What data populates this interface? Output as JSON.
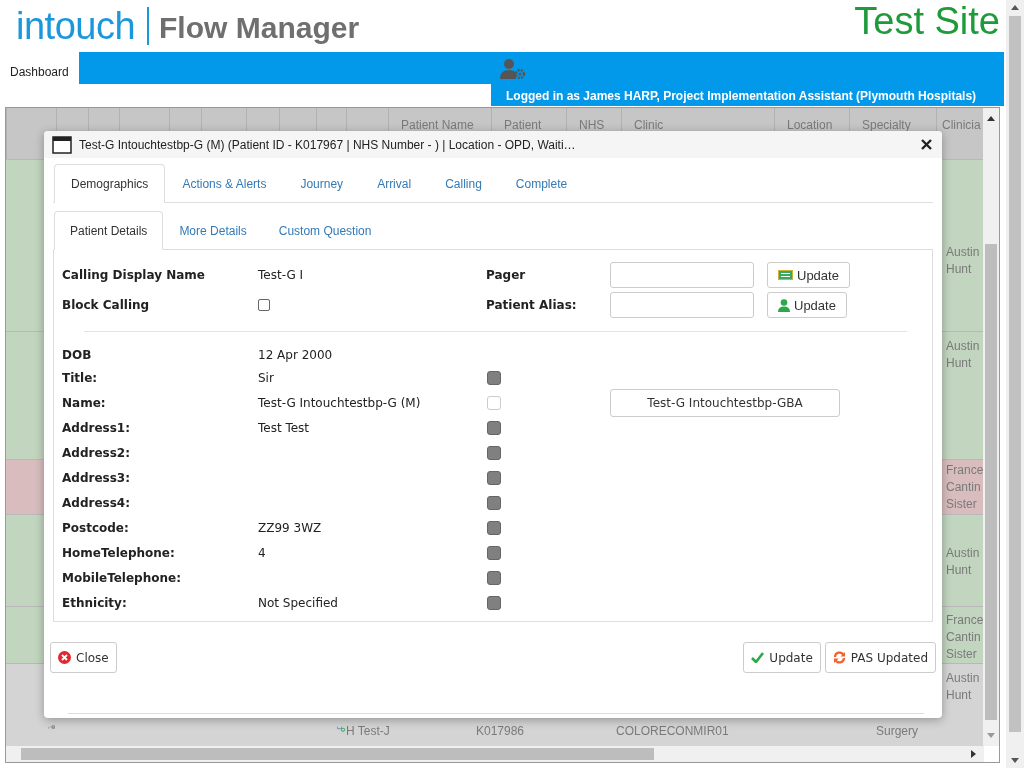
{
  "header": {
    "logo_word": "intouch",
    "app_name": "Flow Manager",
    "site": "Test Site"
  },
  "nav": {
    "tabs": [
      {
        "label": "Dashboard",
        "selected": true
      }
    ],
    "user_status": "Logged in as James HARP, Project Implementation Assistant (Plymouth Hospitals)"
  },
  "table": {
    "columns": [
      "Patient Name",
      "Patient",
      "NHS",
      "Clinic",
      "Location",
      "Specialty",
      "Clinicia"
    ],
    "rows": [
      {
        "color": "#c1d5bf",
        "clinician": "Austin Hunt"
      },
      {
        "color": "#c1d5bf",
        "clinician": "Austin Hunt"
      },
      {
        "color": "#d9bdbe",
        "clinician": "France Cantin Sister"
      },
      {
        "color": "#c1d5bf",
        "clinician": "Austin Hunt"
      },
      {
        "color": "#c1d5bf",
        "clinician": "France Cantin Sister"
      },
      {
        "color": "#d4d4d4",
        "clinician": "Austin Hunt",
        "patient_name": "H Test-J",
        "patient_id": "K017986",
        "clinic": "COLORECONMIR01",
        "specialty": "Surgery"
      }
    ]
  },
  "dialog": {
    "title": "Test-G Intouchtestbp-G (M) (Patient ID - K017967 | NHS Number - ) | Location - OPD, Waiti…",
    "tabs": [
      {
        "label": "Demographics",
        "selected": true
      },
      {
        "label": "Actions & Alerts",
        "selected": false
      },
      {
        "label": "Journey",
        "selected": false
      },
      {
        "label": "Arrival",
        "selected": false
      },
      {
        "label": "Calling",
        "selected": false
      },
      {
        "label": "Complete",
        "selected": false
      }
    ],
    "subtabs": [
      {
        "label": "Patient Details",
        "selected": true
      },
      {
        "label": "More Details",
        "selected": false
      },
      {
        "label": "Custom Question",
        "selected": false
      }
    ],
    "calling_display_name": {
      "label": "Calling Display Name",
      "value": "Test-G I"
    },
    "block_calling": {
      "label": "Block Calling",
      "checked": false
    },
    "pager": {
      "label": "Pager",
      "button": "Update"
    },
    "patient_alias": {
      "label": "Patient Alias:",
      "button": "Update"
    },
    "fields": [
      {
        "label": "DOB",
        "value": "12 Apr 2000"
      },
      {
        "label": "Title:",
        "value": "Sir",
        "checked": true
      },
      {
        "label": "Name:",
        "value": "Test-G Intouchtestbp-G (M)",
        "checked": false,
        "action": "Test-G Intouchtestbp-GBA"
      },
      {
        "label": "Address1:",
        "value": "Test Test",
        "checked": true
      },
      {
        "label": "Address2:",
        "checked": true
      },
      {
        "label": "Address3:",
        "checked": true
      },
      {
        "label": "Address4:",
        "checked": true
      },
      {
        "label": "Postcode:",
        "value": "ZZ99 3WZ",
        "checked": true
      },
      {
        "label": "HomeTelephone:",
        "value": "4",
        "checked": true
      },
      {
        "label": "MobileTelephone:",
        "checked": true
      },
      {
        "label": "Ethnicity:",
        "value": "Not Specified",
        "checked": true
      }
    ],
    "close_button": "Close",
    "update_button": "Update",
    "pas_button": "PAS Updated"
  }
}
